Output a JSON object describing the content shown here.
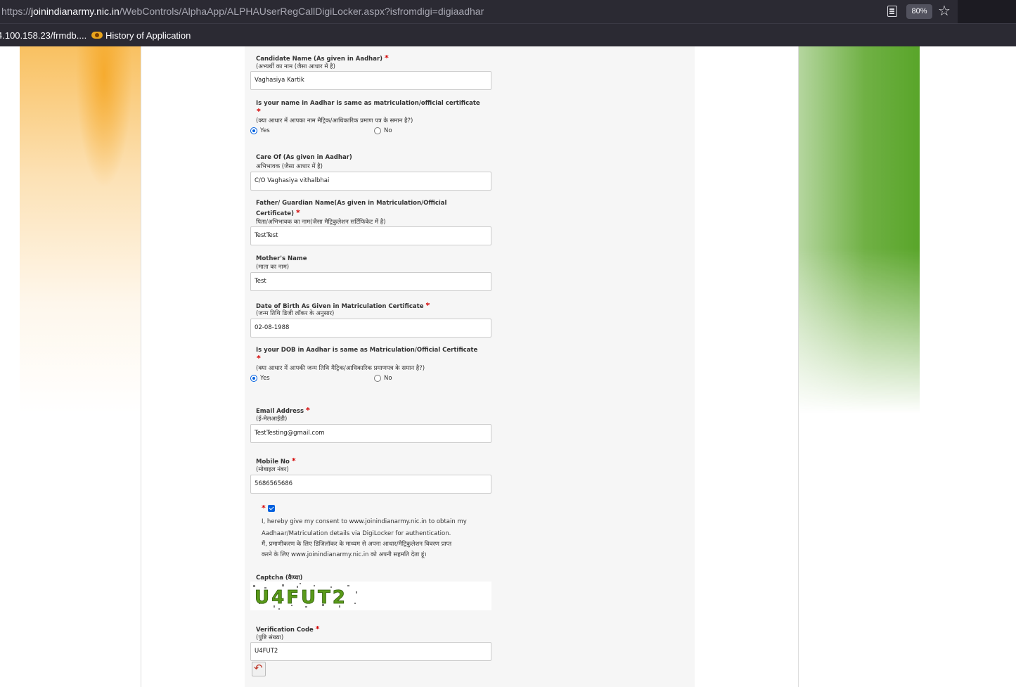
{
  "browser": {
    "url_prefix": "https://",
    "url_host": "joinindianarmy.nic.in",
    "url_path": "/WebControls/AlphaApp/ALPHAUserRegCallDigiLocker.aspx?isfromdigi=digiaadhar",
    "zoom": "80%",
    "bookmarks": [
      "4.100.158.23/frmdb....",
      "History of Application"
    ]
  },
  "form": {
    "candidate_name": {
      "label": "Candidate Name (As given in Aadhar)",
      "hindi": "(अभ्यर्थी का नाम (जैसा आधार में है)",
      "value": "Vaghasiya Kartik"
    },
    "name_same": {
      "label": "Is your name in Aadhar is same as matriculation/official certificate",
      "hindi": "(क्या आधार में आपका नाम मैट्रिक/आधिकारिक प्रमाण पत्र के समान है?)",
      "yes": "Yes",
      "no": "No"
    },
    "care_of": {
      "label": "Care Of (As given in Aadhar)",
      "hindi": "अभिभावक (जैसा आधार में है)",
      "value": "C/O Vaghasiya vithalbhai"
    },
    "father": {
      "label_line1": "Father/ Guardian Name(As given in Matriculation/Official",
      "label_line2": "Certificate)",
      "hindi": "पिता/अभिभावक का नाम(जैसा मैट्रिकुलेशन सर्टिफिकेट में है)",
      "value": "TestTest"
    },
    "mother": {
      "label": "Mother's Name",
      "hindi": "(माता का नाम)",
      "value": "Test"
    },
    "dob": {
      "label": "Date of Birth As Given in Matriculation Certificate",
      "hindi": "(जन्म तिथि डिजी लॉकर के अनुसार)",
      "value": "02-08-1988"
    },
    "dob_same": {
      "label": "Is your DOB in Aadhar is same as Matriculation/Official Certificate",
      "hindi": "(क्या आधार में आपकी जन्म तिथि मैट्रिक/आधिकारिक प्रमाणपत्र के समान है?)",
      "yes": "Yes",
      "no": "No"
    },
    "email": {
      "label": "Email Address",
      "hindi": "(ई-मेलआईडी)",
      "value": "TestTesting@gmail.com"
    },
    "mobile": {
      "label": "Mobile No",
      "hindi": "(मोबाइल नंबर)",
      "value": "5686565686"
    },
    "consent": {
      "line1": "I, hereby give my consent to www.joinindianarmy.nic.in to obtain my",
      "line2": "Aadhaar/Matriculation details via DigiLocker for authentication.",
      "line3": "मैं, प्रमाणीकरण के लिए डिजिलॉकर के माध्यम से अपना आधार/मैट्रिकुलेशन विवरण प्राप्त",
      "line4": "करने के लिए www.joinindianarmy.nic.in को अपनी सहमति देता हूं।"
    },
    "captcha": {
      "label": "Captcha (कैप्चा)",
      "text": "U4FUT2"
    },
    "verification": {
      "label": "Verification Code",
      "hindi": "(पुष्टि संख्या)",
      "value": "U4FUT2"
    },
    "required_mark": "*"
  }
}
